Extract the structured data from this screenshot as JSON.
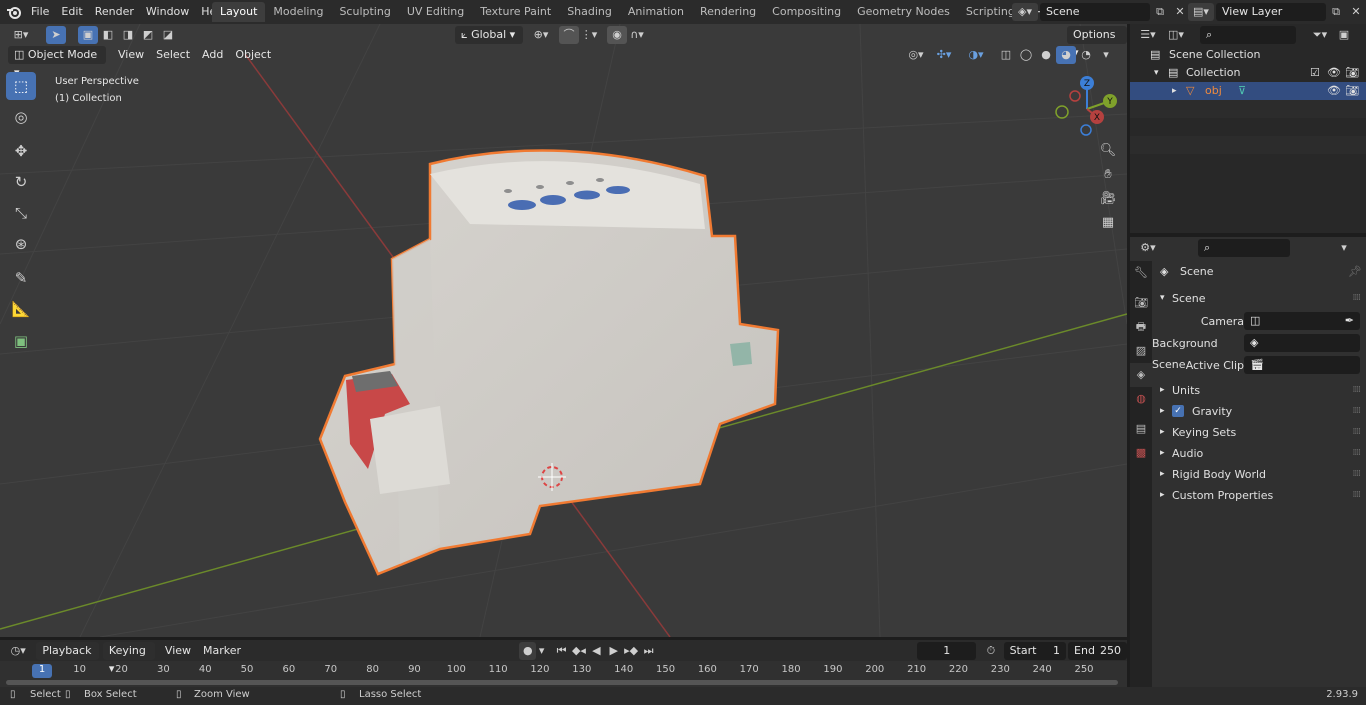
{
  "topbar": {
    "menus": [
      "File",
      "Edit",
      "Render",
      "Window",
      "Help"
    ],
    "workspaces": [
      "Layout",
      "Modeling",
      "Sculpting",
      "UV Editing",
      "Texture Paint",
      "Shading",
      "Animation",
      "Rendering",
      "Compositing",
      "Geometry Nodes",
      "Scripting"
    ],
    "active_workspace": "Layout",
    "add_tab": "+",
    "scene": "Scene",
    "view_layer": "View Layer"
  },
  "tool_header": {
    "orientation": "Global",
    "options": "Options"
  },
  "viewport_header": {
    "mode": "Object Mode",
    "menus": [
      "View",
      "Select",
      "Add",
      "Object"
    ]
  },
  "viewport": {
    "perspective": "User Perspective",
    "collection": "(1) Collection",
    "gizmo": {
      "x": "X",
      "y": "Y",
      "z": "Z"
    }
  },
  "outliner": {
    "scene_collection": "Scene Collection",
    "collection": "Collection",
    "object": "obj"
  },
  "properties": {
    "context": "Scene",
    "section": "Scene",
    "fields": [
      {
        "label": "Camera"
      },
      {
        "label": "Background Scene"
      },
      {
        "label": "Active Clip"
      }
    ],
    "panels": [
      "Units",
      "Gravity",
      "Keying Sets",
      "Audio",
      "Rigid Body World",
      "Custom Properties"
    ],
    "gravity_checked": true
  },
  "timeline": {
    "menus": [
      "Playback",
      "Keying",
      "View",
      "Marker"
    ],
    "current_frame": "1",
    "start_label": "Start",
    "start": "1",
    "end_label": "End",
    "end": "250",
    "ticks": [
      "1",
      "10",
      "20",
      "30",
      "40",
      "50",
      "60",
      "70",
      "80",
      "90",
      "100",
      "110",
      "120",
      "130",
      "140",
      "150",
      "160",
      "170",
      "180",
      "190",
      "200",
      "210",
      "220",
      "230",
      "240",
      "250"
    ]
  },
  "statusbar": {
    "select": "Select",
    "box_select": "Box Select",
    "zoom_view": "Zoom View",
    "lasso_select": "Lasso Select",
    "version": "2.93.9"
  },
  "colors": {
    "accent": "#4772b3",
    "selection_outline": "#f07a32",
    "x_axis": "#b5413f",
    "y_axis": "#7fa12b",
    "z_axis": "#3c7fd8"
  }
}
